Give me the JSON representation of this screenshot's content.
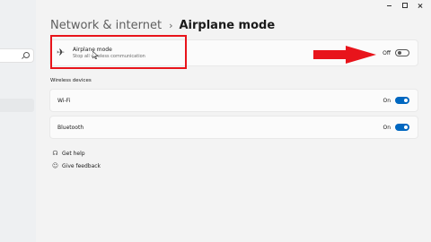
{
  "window": {
    "controls": [
      "minimize",
      "maximize",
      "close"
    ]
  },
  "breadcrumb": {
    "parent": "Network & internet",
    "separator": "›",
    "current": "Airplane mode"
  },
  "airplane_mode": {
    "title": "Airplane mode",
    "description": "Stop all wireless communication",
    "state_label": "Off",
    "enabled": false,
    "icon": "airplane-icon"
  },
  "wireless_devices": {
    "heading": "Wireless devices",
    "items": [
      {
        "label": "Wi-Fi",
        "state_label": "On",
        "enabled": true
      },
      {
        "label": "Bluetooth",
        "state_label": "On",
        "enabled": true
      }
    ]
  },
  "help_links": [
    {
      "label": "Get help",
      "icon": "help-icon"
    },
    {
      "label": "Give feedback",
      "icon": "feedback-icon"
    }
  ],
  "annotation": {
    "highlight_color": "#e8141b"
  },
  "colors": {
    "accent": "#0067c0",
    "background": "#f3f3f3",
    "card": "#fbfbfb"
  }
}
